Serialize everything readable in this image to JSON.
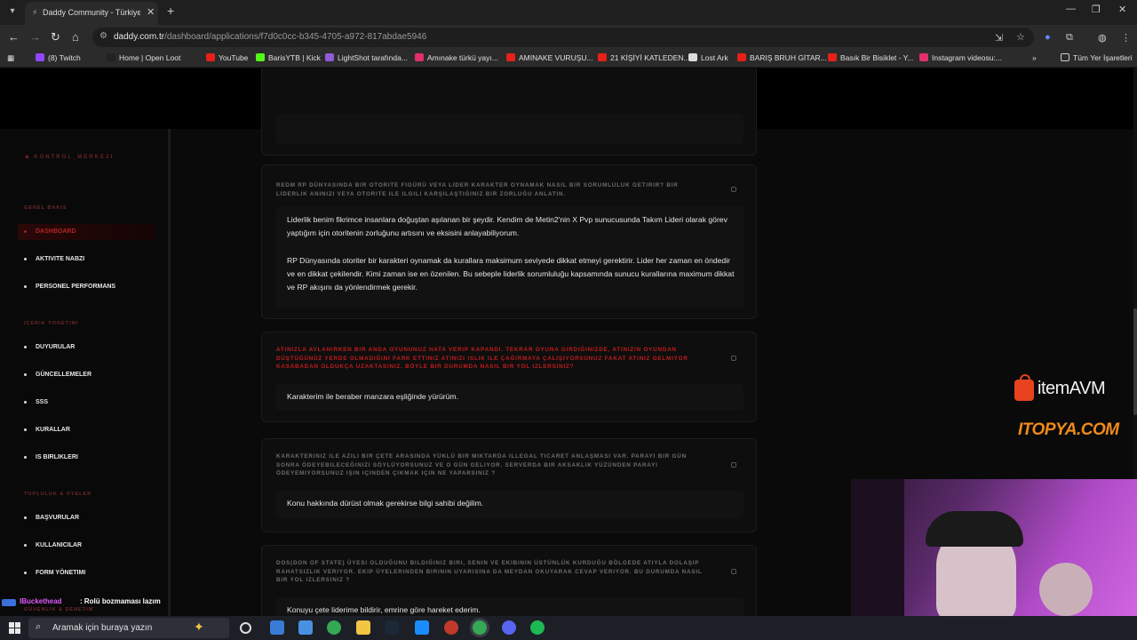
{
  "browser": {
    "tab_title": "Daddy Community - Türkiye'nin",
    "url_domain": "daddy.com.tr",
    "url_path": "/dashboard/applications/f7d0c0cc-b345-4705-a972-817abdae5946",
    "bookmarks": [
      {
        "label": "(8) Twitch",
        "color": "#9146ff"
      },
      {
        "label": "Home | Open Loot",
        "color": "#222"
      },
      {
        "label": "YouTube",
        "color": "#e62117"
      },
      {
        "label": "BarisYTB | Kick",
        "color": "#53fc18"
      },
      {
        "label": "LightShot tarafında...",
        "color": "#8e5bd9"
      },
      {
        "label": "Amınake türkü yayı...",
        "color": "#e1306c"
      },
      {
        "label": "AMINAKE VURUŞU...",
        "color": "#e62117"
      },
      {
        "label": "21 KİŞİYİ KATLEDEN...",
        "color": "#e62117"
      },
      {
        "label": "Lost Ark",
        "color": "#ddd"
      },
      {
        "label": "BARIŞ BRUH GİTAR...",
        "color": "#e62117"
      },
      {
        "label": "Basık Bir Bisiklet - Y...",
        "color": "#e62117"
      },
      {
        "label": "Instagram videosu:...",
        "color": "#e1306c"
      }
    ],
    "all_bookmarks_label": "Tüm Yer İşaretleri"
  },
  "sidebar": {
    "brand": "KONTROL_MERKEZI",
    "groups": [
      {
        "label": "GENEL BAKIS",
        "items": [
          "DASHBOARD",
          "AKTIVITE NABZI",
          "PERSONEL PERFORMANS"
        ]
      },
      {
        "label": "ICERIK YONETIMI",
        "items": [
          "DUYURULAR",
          "GÜNCELLEMELER",
          "SSS",
          "KURALLAR",
          "IS BIRLIKLERI"
        ]
      },
      {
        "label": "TOPLULUK & ÜYELER",
        "items": [
          "BAŞVURULAR",
          "KULLANICILAR",
          "FORM YÖNETIMI"
        ]
      },
      {
        "label": "GÜVENLIK & DENETIM",
        "items": []
      }
    ],
    "active_item": "DASHBOARD"
  },
  "questions": [
    {
      "question": "REDM RP DÜNYASINDA BIR OTORITE FIGÜRÜ VEYA LIDER KARAKTER OYNAMAK NASIL BIR SORUMLULUK GETIRIR? BIR LIDERLIK ANINIZI VEYA OTORITE ILE ILGILI KARŞILAŞTIĞINIZ BIR ZORLUĞU ANLATIN.",
      "answer_p1": "Liderlik benim fikrimce insanlara doğuştan aşılanan bir şeydir. Kendim de Metin2'nin X Pvp sunucusunda Takım Lideri olarak görev yaptığım için otoritenin zorluğunu artısını ve eksisini anlayabiliyorum.",
      "answer_p2": "RP Dünyasında otoriter bir karakteri oynamak da kurallara maksimum seviyede dikkat etmeyi gerektirir. Lider her zaman en öndedir ve en dikkat çekilendir. Kimi zaman ise en özenilen. Bu sebeple liderlik sorumluluğu kapsamında sunucu kurallarına maximum dikkat ve RP akışını da yönlendirmek gerekir."
    },
    {
      "question": "ATINIZLA AVLANIRKEN BIR ANDA OYUNUNUZ HATA VERIP KAPANDI. TEKRAR OYUNA GIRDIĞINIZDE, ATINIZIN OYUNDAN DÜŞTÜĞÜNÜZ YERDE OLMADIĞINI FARK ETTINIZ ATINIZI ISLIK ILE ÇAĞIRMAYA ÇALIŞIYORSUNUZ FAKAT ATINIZ GELMIYOR KASABADAN OLDUKÇA UZAKTASINIZ. BÖYLE BIR DURUMDA NASIL BIR YOL IZLERSINIZ?",
      "answer_p1": "Karakterim ile beraber manzara eşliğinde yürürüm."
    },
    {
      "question": "KARAKTERINIZ ILE AZILI BIR ÇETE ARASINDA YÜKLÜ BIR MIKTARDA ILLEGAL TICARET ANLAŞMASI VAR. PARAYI BIR GÜN SONRA ÖDEYEBILECEĞINIZI SÖYLÜYORSUNUZ VE O GÜN GELIYOR. SERVERDA BIR AKSAKLIK YÜZÜNDEN PARAYI ÖDEYEMIYORSUNUZ IŞIN IÇINDEN ÇIKMAK IÇIN NE YAPARSINIZ ?",
      "answer_p1": "Konu hakkında dürüst olmak gerekirse bilgi sahibi değilim."
    },
    {
      "question": "DOS(DON OF STATE) ÜYESI OLDUĞUNU BILDIĞINIZ BIRI, SENIN VE EKIBININ ÜSTÜNLÜK KURDUĞU BÖLGEDE ATIYLA DOLAŞIP RAHATSIZLIK VERIYOR. EKIP ÜYELERINDEN BIRININ UYARISINA DA MEYDAN OKUYARAK CEVAP VERIYOR. BU DURUMDA NASIL BIR YOL IZLERSINIZ ?",
      "answer_p1": "Konuyu çete liderime bildirir, emrine göre hareket ederim."
    }
  ],
  "overlay": {
    "sponsor1": "itemAVM",
    "sponsor2": "ITOPYA.COM",
    "chat_user": "IBucket­head",
    "chat_message": ": Rolü bozmaması lazım"
  },
  "taskbar": {
    "search_placeholder": "Aramak için buraya yazın"
  }
}
